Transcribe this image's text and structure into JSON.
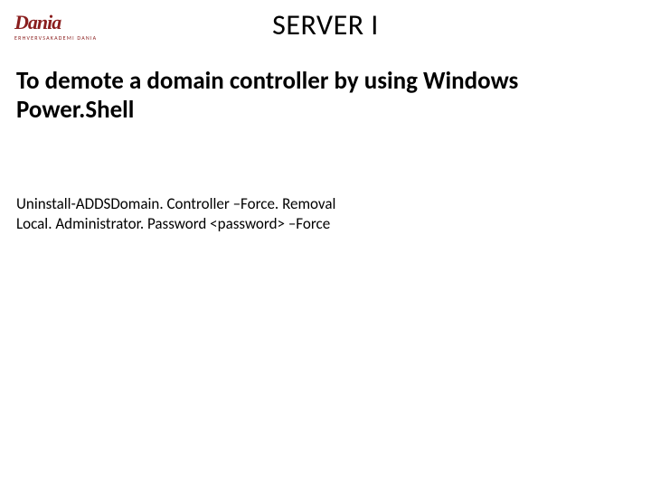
{
  "logo": {
    "word": "Dania",
    "subtitle": "ERHVERVSAKADEMI DANIA"
  },
  "title": "SERVER I",
  "heading": "To demote a domain controller by using Windows Power.Shell",
  "command_line_1": "Uninstall-ADDSDomain. Controller –Force. Removal",
  "command_line_2": "Local. Administrator. Password <password> –Force"
}
